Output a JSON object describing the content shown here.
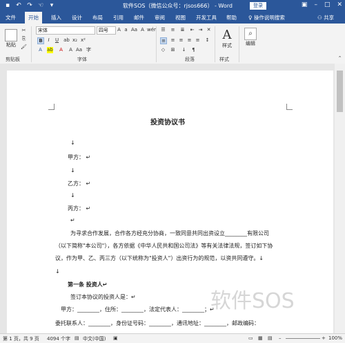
{
  "titlebar": {
    "title": "软件SOS（微信公众号：rjsos666） - Word",
    "login": "登录",
    "qat": [
      "save-icon",
      "undo-icon",
      "redo-icon",
      "touch-icon",
      "customize-icon"
    ]
  },
  "tabs": [
    "文件",
    "开始",
    "插入",
    "设计",
    "布局",
    "引用",
    "邮件",
    "审阅",
    "视图",
    "开发工具",
    "帮助",
    "操作说明搜索",
    "共享"
  ],
  "ribbon": {
    "paste": "粘贴",
    "clipboard": "剪贴板",
    "font_name": "宋体",
    "font_size": "四号",
    "font_group": "字体",
    "para_group": "段落",
    "styles": "样式",
    "styles_group": "样式",
    "edit": "编辑",
    "wen": "wén",
    "A_big": "A"
  },
  "document": {
    "title": "投资协议书",
    "lines": [
      "↓",
      "甲方：  ↵",
      "↓",
      "乙方：  ↵",
      "↓",
      "丙方：  ↵",
      "↵",
      "为寻求合作发展，合作各方经充分协商，一致同意共同出资设立________有限公司",
      "（以下简称\"本公司\"），各方依据《中华人民共和国公司法》等有关法律法规，签订如下协",
      "议，作为甲、乙、丙三方（以下统称为\"投资人\"）出资行为的规范，以资共同遵守。↓",
      "↓",
      "第一条   投资人↵",
      "签订本协议的投资人是：↵",
      "甲方：________，住所：________，法定代表人：________；↵",
      "委托联系人：________，身份证号码：________，通讯地址：________，邮政编码："
    ]
  },
  "status": {
    "page": "第 1 页，共 9 页",
    "words": "4094 个字",
    "lang": "中文(中国)",
    "zoom": "100%"
  },
  "watermark": "软件SOS"
}
